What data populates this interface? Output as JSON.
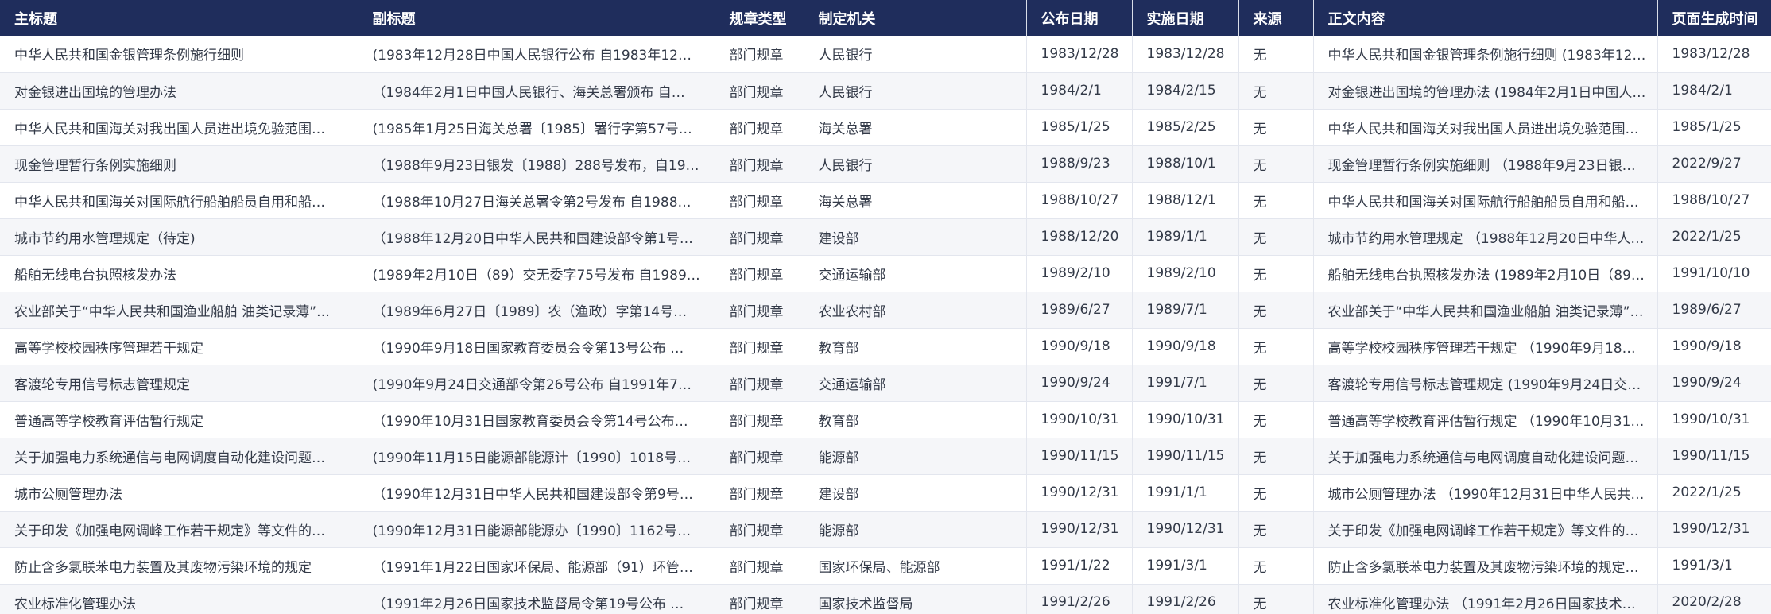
{
  "table": {
    "columns": [
      "主标题",
      "副标题",
      "规章类型",
      "制定机关",
      "公布日期",
      "实施日期",
      "来源",
      "正文内容",
      "页面生成时间"
    ],
    "rows": [
      [
        "中华人民共和国金银管理条例施行细则",
        "(1983年12月28日中国人民银行公布 自1983年12…",
        "部门规章",
        "人民银行",
        "1983/12/28",
        "1983/12/28",
        "无",
        "中华人民共和国金银管理条例施行细则 (1983年12…",
        "1983/12/28"
      ],
      [
        "对金银进出国境的管理办法",
        "（1984年2月1日中国人民银行、海关总署颁布 自…",
        "部门规章",
        "人民银行",
        "1984/2/1",
        "1984/2/15",
        "无",
        "对金银进出国境的管理办法 (1984年2月1日中国人…",
        "1984/2/1"
      ],
      [
        "中华人民共和国海关对我出国人员进出境免验范围…",
        "(1985年1月25日海关总署〔1985〕署行字第57号…",
        "部门规章",
        "海关总署",
        "1985/1/25",
        "1985/2/25",
        "无",
        "中华人民共和国海关对我出国人员进出境免验范围…",
        "1985/1/25"
      ],
      [
        "现金管理暂行条例实施细则",
        "（1988年9月23日银发〔1988〕288号发布，自19…",
        "部门规章",
        "人民银行",
        "1988/9/23",
        "1988/10/1",
        "无",
        "现金管理暂行条例实施细则 （1988年9月23日银…",
        "2022/9/27"
      ],
      [
        "中华人民共和国海关对国际航行船舶船员自用和船…",
        "（1988年10月27日海关总署令第2号发布 自1988…",
        "部门规章",
        "海关总署",
        "1988/10/27",
        "1988/12/1",
        "无",
        "中华人民共和国海关对国际航行船舶船员自用和船…",
        "1988/10/27"
      ],
      [
        "城市节约用水管理规定（待定)",
        "（1988年12月20日中华人民共和国建设部令第1号…",
        "部门规章",
        "建设部",
        "1988/12/20",
        "1989/1/1",
        "无",
        "城市节约用水管理规定 （1988年12月20日中华人…",
        "2022/1/25"
      ],
      [
        "船舶无线电台执照核发办法",
        "(1989年2月10日（89）交无委字75号发布 自1989…",
        "部门规章",
        "交通运输部",
        "1989/2/10",
        "1989/2/10",
        "无",
        "船舶无线电台执照核发办法 (1989年2月10日（89…",
        "1991/10/10"
      ],
      [
        "农业部关于“中华人民共和国渔业船舶 油类记录薄”…",
        "（1989年6月27日〔1989〕农（渔政）字第14号…",
        "部门规章",
        "农业农村部",
        "1989/6/27",
        "1989/7/1",
        "无",
        "农业部关于“中华人民共和国渔业船舶 油类记录薄”…",
        "1989/6/27"
      ],
      [
        "高等学校校园秩序管理若干规定",
        "（1990年9月18日国家教育委员会令第13号公布 …",
        "部门规章",
        "教育部",
        "1990/9/18",
        "1990/9/18",
        "无",
        "高等学校校园秩序管理若干规定 （1990年9月18…",
        "1990/9/18"
      ],
      [
        "客渡轮专用信号标志管理规定",
        "(1990年9月24日交通部令第26号公布 自1991年7…",
        "部门规章",
        "交通运输部",
        "1990/9/24",
        "1991/7/1",
        "无",
        "客渡轮专用信号标志管理规定 (1990年9月24日交…",
        "1990/9/24"
      ],
      [
        "普通高等学校教育评估暂行规定",
        "（1990年10月31日国家教育委员会令第14号公布…",
        "部门规章",
        "教育部",
        "1990/10/31",
        "1990/10/31",
        "无",
        "普通高等学校教育评估暂行规定 （1990年10月31…",
        "1990/10/31"
      ],
      [
        "关于加强电力系统通信与电网调度自动化建设问题…",
        "(1990年11月15日能源部能源计〔1990〕1018号…",
        "部门规章",
        "能源部",
        "1990/11/15",
        "1990/11/15",
        "无",
        "关于加强电力系统通信与电网调度自动化建设问题…",
        "1990/11/15"
      ],
      [
        "城市公厕管理办法",
        "（1990年12月31日中华人民共和国建设部令第9号…",
        "部门规章",
        "建设部",
        "1990/12/31",
        "1991/1/1",
        "无",
        "城市公厕管理办法 （1990年12月31日中华人民共…",
        "2022/1/25"
      ],
      [
        "关于印发《加强电网调峰工作若干规定》等文件的…",
        "(1990年12月31日能源部能源办〔1990〕1162号…",
        "部门规章",
        "能源部",
        "1990/12/31",
        "1990/12/31",
        "无",
        "关于印发《加强电网调峰工作若干规定》等文件的…",
        "1990/12/31"
      ],
      [
        "防止含多氯联苯电力装置及其废物污染环境的规定",
        "（1991年1月22日国家环保局、能源部（91）环管…",
        "部门规章",
        "国家环保局、能源部",
        "1991/1/22",
        "1991/3/1",
        "无",
        "防止含多氯联苯电力装置及其废物污染环境的规定…",
        "1991/3/1"
      ],
      [
        "农业标准化管理办法",
        "（1991年2月26日国家技术监督局令第19号公布 …",
        "部门规章",
        "国家技术监督局",
        "1991/2/26",
        "1991/2/26",
        "无",
        "农业标准化管理办法 （1991年2月26日国家技术…",
        "2020/2/28"
      ]
    ]
  }
}
